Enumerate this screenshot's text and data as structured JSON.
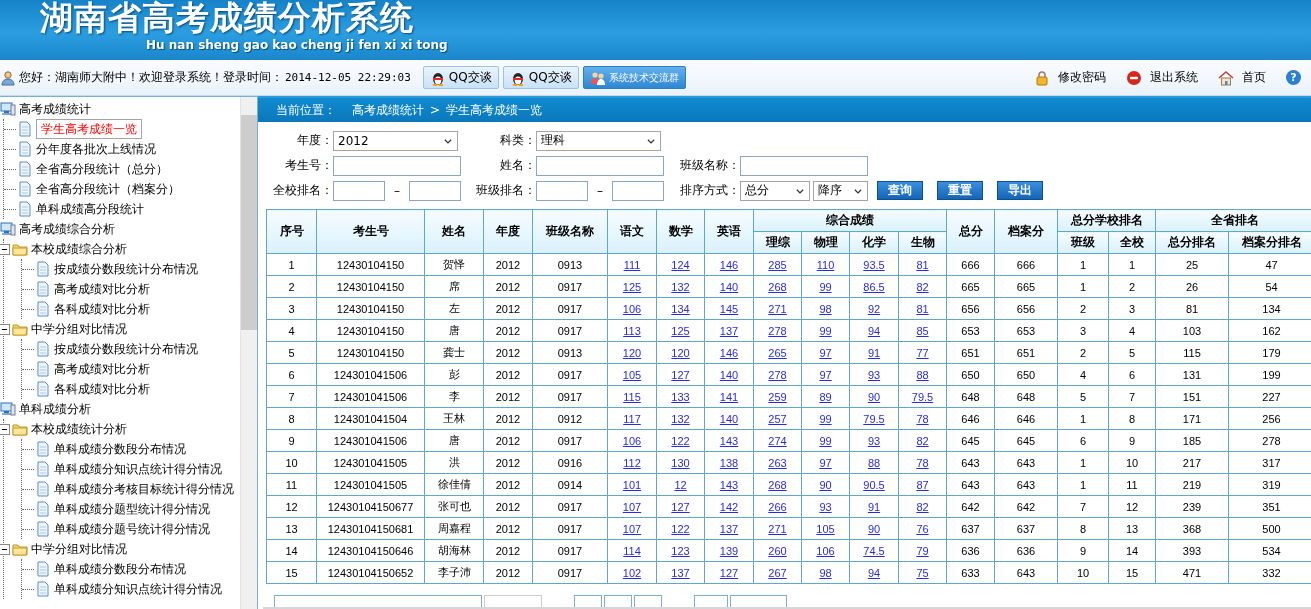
{
  "header": {
    "title": "湖南省高考成绩分析系统",
    "subtitle": "Hu nan sheng gao kao cheng ji fen xi xi tong"
  },
  "top_bar": {
    "greeting": "您好：湖南师大附中！欢迎登录系统！登录时间：",
    "login_time": "2014-12-05 22:29:03",
    "buttons": [
      {
        "kind": "qq",
        "label": "QQ交谈"
      },
      {
        "kind": "qq",
        "label": "QQ交谈"
      },
      {
        "kind": "group",
        "label": "系统技术交流群"
      }
    ],
    "links": [
      {
        "kind": "lock",
        "label": "修改密码"
      },
      {
        "kind": "exit",
        "label": "退出系统"
      },
      {
        "kind": "home",
        "label": "首页"
      },
      {
        "kind": "help",
        "label": "?"
      }
    ]
  },
  "sidebar": {
    "items": [
      {
        "kind": "group",
        "label": "高考成绩统计",
        "children": [
          {
            "kind": "page",
            "label": "学生高考成绩一览",
            "selected": true
          },
          {
            "kind": "page",
            "label": "分年度各批次上线情况",
            "selected": false
          },
          {
            "kind": "page",
            "label": "全省高分段统计（总分）",
            "selected": false
          },
          {
            "kind": "page",
            "label": "全省高分段统计（档案分）",
            "selected": false
          },
          {
            "kind": "page",
            "label": "单科成绩高分段统计",
            "selected": false
          }
        ]
      },
      {
        "kind": "group",
        "label": "高考成绩综合分析",
        "children": [
          {
            "kind": "folder",
            "label": "本校成绩综合分析",
            "expanded": true,
            "children": [
              {
                "kind": "page",
                "label": "按成绩分数段统计分布情况",
                "selected": false
              },
              {
                "kind": "page",
                "label": "高考成绩对比分析",
                "selected": false
              },
              {
                "kind": "page",
                "label": "各科成绩对比分析",
                "selected": false
              }
            ]
          },
          {
            "kind": "folder",
            "label": "中学分组对比情况",
            "expanded": true,
            "children": [
              {
                "kind": "page",
                "label": "按成绩分数段统计分布情况",
                "selected": false
              },
              {
                "kind": "page",
                "label": "高考成绩对比分析",
                "selected": false
              },
              {
                "kind": "page",
                "label": "各科成绩对比分析",
                "selected": false
              }
            ]
          }
        ]
      },
      {
        "kind": "group",
        "label": "单科成绩分析",
        "children": [
          {
            "kind": "folder",
            "label": "本校成绩统计分析",
            "expanded": true,
            "children": [
              {
                "kind": "page",
                "label": "单科成绩分数段分布情况",
                "selected": false
              },
              {
                "kind": "page",
                "label": "单科成绩分知识点统计得分情况",
                "selected": false
              },
              {
                "kind": "page",
                "label": "单科成绩分考核目标统计得分情况",
                "selected": false
              },
              {
                "kind": "page",
                "label": "单科成绩分题型统计得分情况",
                "selected": false
              },
              {
                "kind": "page",
                "label": "单科成绩分题号统计得分情况",
                "selected": false
              }
            ]
          },
          {
            "kind": "folder",
            "label": "中学分组对比情况",
            "expanded": true,
            "children": [
              {
                "kind": "page",
                "label": "单科成绩分数段分布情况",
                "selected": false
              },
              {
                "kind": "page",
                "label": "单科成绩分知识点统计得分情况",
                "selected": false
              }
            ]
          }
        ]
      }
    ]
  },
  "breadcrumb": {
    "label": "当前位置：",
    "path": [
      "高考成绩统计",
      "学生高考成绩一览"
    ],
    "separator": ">"
  },
  "filters": [
    [
      {
        "kind": "select",
        "label": "年度：",
        "value": "2012"
      },
      {
        "kind": "select",
        "label": "科类：",
        "value": "理科"
      }
    ],
    [
      {
        "kind": "input",
        "label": "考生号："
      },
      {
        "kind": "input",
        "label": "姓名："
      },
      {
        "kind": "input",
        "label": "班级名称："
      }
    ],
    [
      {
        "kind": "range",
        "label": "全校排名：",
        "separator": "–"
      },
      {
        "kind": "range",
        "label": "班级排名：",
        "separator": "–"
      },
      {
        "kind": "selects",
        "label": "排序方式：",
        "values": [
          "总分",
          "降序"
        ]
      }
    ]
  ],
  "actions": [
    "查询",
    "重置",
    "导出"
  ],
  "table": {
    "columns": [
      {
        "label": "序号"
      },
      {
        "label": "考生号"
      },
      {
        "label": "姓名"
      },
      {
        "label": "年度"
      },
      {
        "label": "班级名称"
      },
      {
        "label": "语文",
        "link": true
      },
      {
        "label": "数学",
        "link": true
      },
      {
        "label": "英语",
        "link": true
      },
      {
        "label": "综合成绩",
        "colspan": 4,
        "children": [
          {
            "label": "理综",
            "link": true
          },
          {
            "label": "物理",
            "link": true
          },
          {
            "label": "化学",
            "link": true
          },
          {
            "label": "生物",
            "link": true
          }
        ]
      },
      {
        "label": "总分"
      },
      {
        "label": "档案分"
      },
      {
        "label": "总分学校排名",
        "colspan": 2,
        "children": [
          {
            "label": "班级"
          },
          {
            "label": "全校"
          }
        ]
      },
      {
        "label": "全省排名",
        "colspan": 2,
        "children": [
          {
            "label": "总分排名"
          },
          {
            "label": "档案分排名"
          }
        ]
      }
    ],
    "rows": [
      [
        "1",
        "12430104150",
        "贺怿",
        "2012",
        "0913",
        "111",
        "124",
        "146",
        "285",
        "110",
        "93.5",
        "81",
        "666",
        "666",
        "1",
        "1",
        "25",
        "47"
      ],
      [
        "2",
        "12430104150",
        "席",
        "2012",
        "0917",
        "125",
        "132",
        "140",
        "268",
        "99",
        "86.5",
        "82",
        "665",
        "665",
        "1",
        "2",
        "26",
        "54"
      ],
      [
        "3",
        "12430104150",
        "左",
        "2012",
        "0917",
        "106",
        "134",
        "145",
        "271",
        "98",
        "92",
        "81",
        "656",
        "656",
        "2",
        "3",
        "81",
        "134"
      ],
      [
        "4",
        "12430104150",
        "唐",
        "2012",
        "0917",
        "113",
        "125",
        "137",
        "278",
        "99",
        "94",
        "85",
        "653",
        "653",
        "3",
        "4",
        "103",
        "162"
      ],
      [
        "5",
        "12430104150",
        "龚士",
        "2012",
        "0913",
        "120",
        "120",
        "146",
        "265",
        "97",
        "91",
        "77",
        "651",
        "651",
        "2",
        "5",
        "115",
        "179"
      ],
      [
        "6",
        "124301041506",
        "彭",
        "2012",
        "0917",
        "105",
        "127",
        "140",
        "278",
        "97",
        "93",
        "88",
        "650",
        "650",
        "4",
        "6",
        "131",
        "199"
      ],
      [
        "7",
        "124301041506",
        "李",
        "2012",
        "0917",
        "115",
        "133",
        "141",
        "259",
        "89",
        "90",
        "79.5",
        "648",
        "648",
        "5",
        "7",
        "151",
        "227"
      ],
      [
        "8",
        "124301041504",
        "王林",
        "2012",
        "0912",
        "117",
        "132",
        "140",
        "257",
        "99",
        "79.5",
        "78",
        "646",
        "646",
        "1",
        "8",
        "171",
        "256"
      ],
      [
        "9",
        "124301041506",
        "唐",
        "2012",
        "0917",
        "106",
        "122",
        "143",
        "274",
        "99",
        "93",
        "82",
        "645",
        "645",
        "6",
        "9",
        "185",
        "278"
      ],
      [
        "10",
        "124301041505",
        "洪",
        "2012",
        "0916",
        "112",
        "130",
        "138",
        "263",
        "97",
        "88",
        "78",
        "643",
        "643",
        "1",
        "10",
        "217",
        "317"
      ],
      [
        "11",
        "124301041505",
        "徐佳倩",
        "2012",
        "0914",
        "101",
        "12",
        "143",
        "268",
        "90",
        "90.5",
        "87",
        "643",
        "643",
        "1",
        "11",
        "219",
        "319"
      ],
      [
        "12",
        "12430104150677",
        "张可也",
        "2012",
        "0917",
        "107",
        "127",
        "142",
        "266",
        "93",
        "91",
        "82",
        "642",
        "642",
        "7",
        "12",
        "239",
        "351"
      ],
      [
        "13",
        "12430104150681",
        "周嘉程",
        "2012",
        "0917",
        "107",
        "122",
        "137",
        "271",
        "105",
        "90",
        "76",
        "637",
        "637",
        "8",
        "13",
        "368",
        "500"
      ],
      [
        "14",
        "12430104150646",
        "胡海林",
        "2012",
        "0917",
        "114",
        "123",
        "139",
        "260",
        "106",
        "74.5",
        "79",
        "636",
        "636",
        "9",
        "14",
        "393",
        "534"
      ],
      [
        "15",
        "12430104150652",
        "李子沛",
        "2012",
        "0917",
        "102",
        "137",
        "127",
        "267",
        "98",
        "94",
        "75",
        "633",
        "643",
        "10",
        "15",
        "471",
        "332"
      ]
    ]
  }
}
